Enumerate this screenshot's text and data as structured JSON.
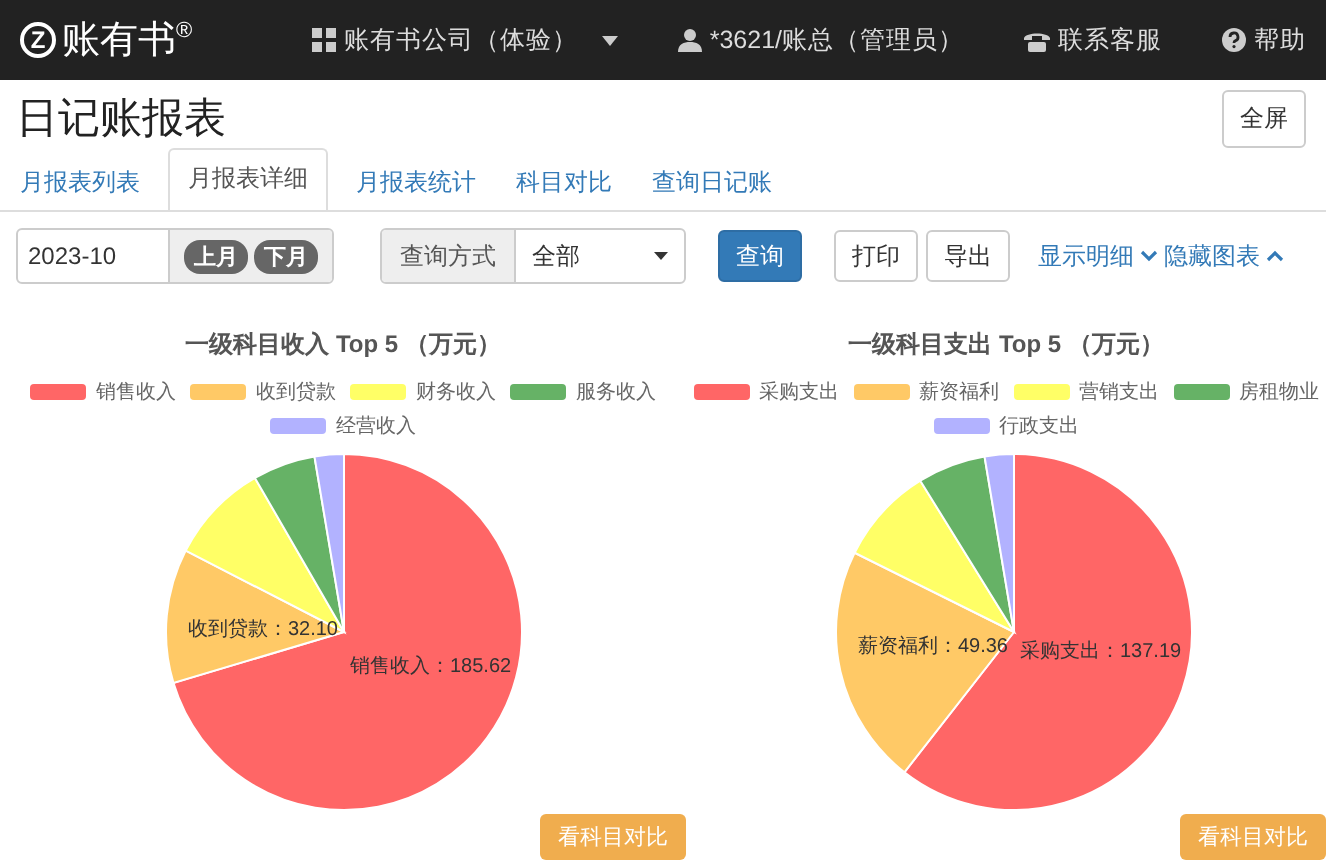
{
  "navbar": {
    "logo_mark": "Z",
    "logo": "账有书",
    "logo_sup": "®",
    "company": "账有书公司（体验）",
    "user": "*3621/账总（管理员）",
    "service": "联系客服",
    "help": "帮助"
  },
  "page": {
    "title": "日记账报表",
    "fullscreen_button": "全屏"
  },
  "tabs": [
    {
      "label": "月报表列表",
      "selected": false
    },
    {
      "label": "月报表详细",
      "selected": true
    },
    {
      "label": "月报表统计",
      "selected": false
    },
    {
      "label": "科目对比",
      "selected": false
    },
    {
      "label": "查询日记账",
      "selected": false
    }
  ],
  "toolbar": {
    "month": "2023-10",
    "prev_month": "上月",
    "next_month": "下月",
    "query_mode_label": "查询方式",
    "query_mode": "全部",
    "query_button": "查询",
    "print_button": "打印",
    "export_button": "导出",
    "show_details": "显示明细",
    "hide_charts": "隐藏图表"
  },
  "charts": [
    {
      "chart_data": {
        "type": "pie",
        "title": "一级科目收入 Top 5 （万元）",
        "categories": [
          "销售收入",
          "收到贷款",
          "财务收入",
          "服务收入",
          "经营收入"
        ],
        "values": [
          185.62,
          32.1,
          24,
          15,
          7
        ],
        "colors": [
          "#ff6666",
          "#ffc966",
          "#ffff66",
          "#66b266",
          "#b2b2ff"
        ],
        "value_labels": [
          "销售收入：185.62",
          "收到贷款：32.10",
          null,
          null,
          null
        ]
      },
      "compare_button": "看科目对比"
    },
    {
      "chart_data": {
        "type": "pie",
        "title": "一级科目支出 Top 5 （万元）",
        "categories": [
          "采购支出",
          "薪资福利",
          "营销支出",
          "房租物业",
          "行政支出"
        ],
        "values": [
          137.19,
          49.36,
          20,
          14,
          6
        ],
        "colors": [
          "#ff6666",
          "#ffc966",
          "#ffff66",
          "#66b266",
          "#b2b2ff"
        ],
        "value_labels": [
          "采购支出：137.19",
          "薪资福利：49.36",
          null,
          null,
          null
        ]
      },
      "compare_button": "看科目对比"
    }
  ]
}
